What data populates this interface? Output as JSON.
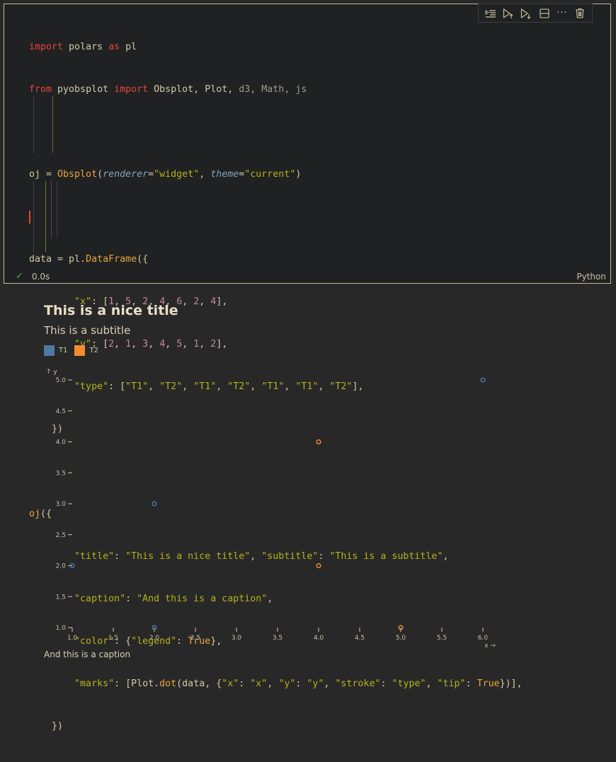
{
  "notebook": {
    "cell": {
      "language": "Python",
      "exec_status": "0.0s",
      "code": {
        "line1": {
          "kw1": "import",
          "mod": " polars ",
          "kw2": "as",
          "alias": " pl"
        },
        "line2": {
          "kw1": "from",
          "mod": " pyobsplot ",
          "kw2": "import",
          "names": " Obsplot, Plot, ",
          "rest": "d3, Math, js"
        },
        "line4": {
          "var": "oj = ",
          "fn": "Obsplot",
          "p1": "(",
          "param1": "renderer",
          "eq1": "=",
          "str1": "\"widget\"",
          "comma": ", ",
          "param2": "theme",
          "eq2": "=",
          "str2": "\"current\"",
          "close": ")"
        },
        "line6": {
          "var": "data = pl.",
          "fn": "DataFrame",
          "rest": "({"
        },
        "line7": {
          "key": "\"x\"",
          "sep": ": [",
          "vals": [
            "1",
            "5",
            "2",
            "4",
            "6",
            "2",
            "4"
          ],
          "end": "],"
        },
        "line8": {
          "key": "\"y\"",
          "sep": ": [",
          "vals": [
            "2",
            "1",
            "3",
            "4",
            "5",
            "1",
            "2"
          ],
          "end": "],"
        },
        "line9": {
          "key": "\"type\"",
          "sep": ": [",
          "vals": [
            "\"T1\"",
            "\"T2\"",
            "\"T1\"",
            "\"T2\"",
            "\"T1\"",
            "\"T1\"",
            "\"T2\""
          ],
          "end": "],"
        },
        "line10": "})",
        "line12": {
          "fn": "oj",
          "rest": "({"
        },
        "line13": {
          "k1": "\"title\"",
          "v1": "\"This is a nice title\"",
          "k2": "\"subtitle\"",
          "v2": "\"This is a subtitle\""
        },
        "line14": {
          "k": "\"caption\"",
          "v": "\"And this is a caption\""
        },
        "line15": {
          "k": "\"color\"",
          "open": ": {",
          "k2": "\"legend\"",
          "sep": ": ",
          "v": "True",
          "close": "},"
        },
        "line16": {
          "k": "\"marks\"",
          "open": ": [Plot.",
          "fn": "dot",
          "args1": "(data, {",
          "kx": "\"x\"",
          "vx": "\"x\"",
          "ky": "\"y\"",
          "vy": "\"y\"",
          "ks": "\"stroke\"",
          "vs": "\"type\"",
          "kt": "\"tip\"",
          "vt": "True",
          "close": "})],"
        },
        "line17": "})"
      }
    },
    "toolbar": {
      "buttons": [
        {
          "name": "run-by-line-button",
          "icon": "run-by-line-icon"
        },
        {
          "name": "execute-above-button",
          "icon": "run-above-icon"
        },
        {
          "name": "execute-below-button",
          "icon": "run-below-icon"
        },
        {
          "name": "split-cell-button",
          "icon": "split-icon"
        },
        {
          "name": "more-actions-button",
          "icon": "ellipsis-icon",
          "glyph": "···"
        },
        {
          "name": "delete-cell-button",
          "icon": "trash-icon"
        }
      ]
    },
    "output": {
      "title": "This is a nice title",
      "subtitle": "This is a subtitle",
      "caption": "And this is a caption",
      "legend": [
        {
          "label": "T1",
          "color": "#4e79a7"
        },
        {
          "label": "T2",
          "color": "#f28e2c"
        }
      ]
    }
  },
  "chart_data": {
    "type": "scatter",
    "title": "This is a nice title",
    "subtitle": "This is a subtitle",
    "caption": "And this is a caption",
    "xlabel": "x →",
    "ylabel": "↑ y",
    "xlim": [
      1,
      6
    ],
    "ylim": [
      1,
      5
    ],
    "xticks": [
      "1.0",
      "1.5",
      "2.0",
      "2.5",
      "3.0",
      "3.5",
      "4.0",
      "4.5",
      "5.0",
      "5.5",
      "6.0"
    ],
    "yticks": [
      "1.0",
      "1.5",
      "2.0",
      "2.5",
      "3.0",
      "3.5",
      "4.0",
      "4.5",
      "5.0"
    ],
    "grid": false,
    "legend_position": "top-left",
    "series": [
      {
        "name": "T1",
        "color": "#4e79a7",
        "points": [
          [
            1,
            2
          ],
          [
            2,
            3
          ],
          [
            6,
            5
          ],
          [
            2,
            1
          ]
        ]
      },
      {
        "name": "T2",
        "color": "#f28e2c",
        "points": [
          [
            5,
            1
          ],
          [
            4,
            4
          ],
          [
            4,
            2
          ]
        ]
      }
    ]
  }
}
